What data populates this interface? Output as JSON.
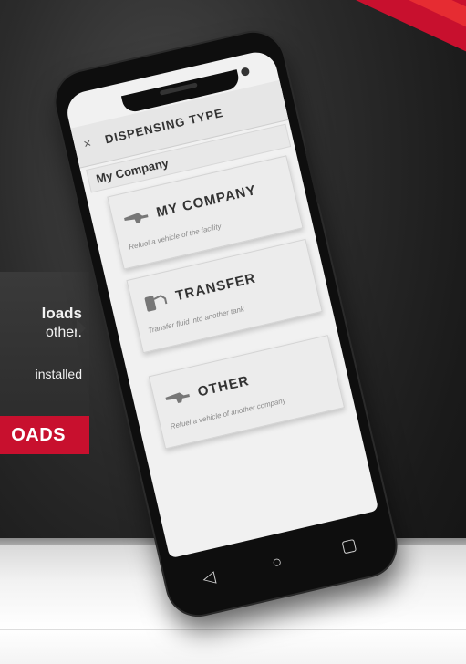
{
  "promo": {
    "line1": "loads",
    "line2": "other.",
    "line3": "installed",
    "cta": "OADS"
  },
  "app": {
    "close_glyph": "×",
    "title": "DISPENSING TYPE",
    "group_label": "My Company",
    "options": [
      {
        "icon": "fuel-nozzle-icon",
        "label": "MY COMPANY",
        "description": "Refuel a vehicle of the facility"
      },
      {
        "icon": "fuel-pump-icon",
        "label": "TRANSFER",
        "description": "Transfer fluid into another tank"
      },
      {
        "icon": "fuel-nozzle-icon",
        "label": "OTHER",
        "description": "Refuel a vehicle of another company"
      }
    ]
  },
  "navbar": {
    "back_glyph": "◁",
    "home_glyph": "○",
    "recent_glyph": "▢"
  },
  "colors": {
    "brand_red": "#c8102e",
    "panel_dark": "#2e2e2e",
    "screen_bg": "#f1f1f1"
  }
}
